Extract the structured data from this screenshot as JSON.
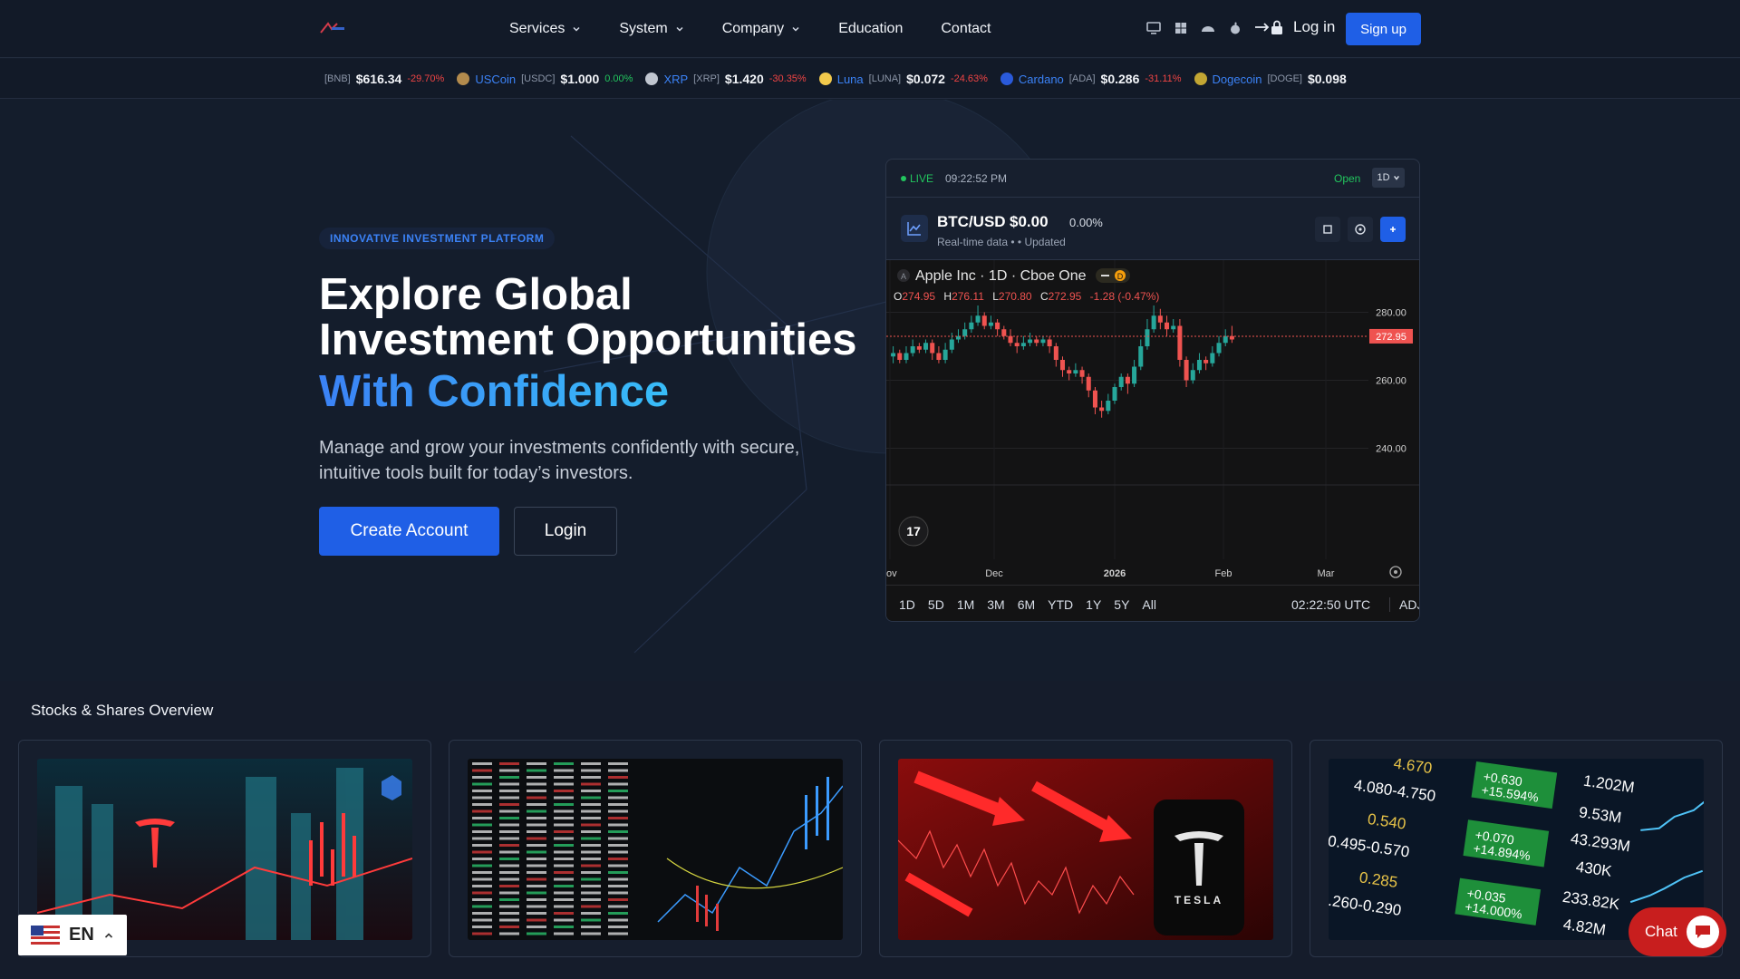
{
  "nav": {
    "menu": [
      {
        "label": "Services",
        "dropdown": true
      },
      {
        "label": "System",
        "dropdown": true
      },
      {
        "label": "Company",
        "dropdown": true
      },
      {
        "label": "Education",
        "dropdown": false
      },
      {
        "label": "Contact",
        "dropdown": false
      }
    ],
    "os_icons": [
      "desktop-icon",
      "windows-icon",
      "android-icon",
      "apple-icon"
    ],
    "login_label": "Log in",
    "signup_label": "Sign up"
  },
  "ticker": [
    {
      "name": "",
      "symbol": "[BNB]",
      "price": "$616.34",
      "change": "-29.70%",
      "dir": "neg",
      "color": "#f3ba2f"
    },
    {
      "name": "USCoin",
      "symbol": "[USDC]",
      "price": "$1.000",
      "change": "0.00%",
      "dir": "pos",
      "color": "#b38b4d"
    },
    {
      "name": "XRP",
      "symbol": "[XRP]",
      "price": "$1.420",
      "change": "-30.35%",
      "dir": "neg",
      "color": "#c0c6d0"
    },
    {
      "name": "Luna",
      "symbol": "[LUNA]",
      "price": "$0.072",
      "change": "-24.63%",
      "dir": "neg",
      "color": "#f2c94c"
    },
    {
      "name": "Cardano",
      "symbol": "[ADA]",
      "price": "$0.286",
      "change": "-31.11%",
      "dir": "neg",
      "color": "#2a5ada"
    },
    {
      "name": "Dogecoin",
      "symbol": "[DOGE]",
      "price": "$0.098",
      "change": "",
      "dir": "neg",
      "color": "#c2a633"
    }
  ],
  "hero": {
    "badge": "INNOVATIVE INVESTMENT PLATFORM",
    "title": "Explore Global Investment Opportunities",
    "accent": "With Confidence",
    "subtitle": "Manage and grow your investments confidently with secure, intuitive tools built for today’s investors.",
    "primary_cta": "Create Account",
    "secondary_cta": "Login"
  },
  "widget": {
    "live_label": "LIVE",
    "clock": "09:22:52 PM",
    "status": "Open",
    "period": "1D",
    "pair": "BTC/USD",
    "price": "$0.00",
    "change": "0.00%",
    "meta": "Real-time data •  • Updated",
    "symbol_line": "Apple Inc · 1D · Cboe One",
    "ohlc": {
      "o_label": "O",
      "o": "274.95",
      "h_label": "H",
      "h": "276.11",
      "l_label": "L",
      "l": "270.80",
      "c_label": "C",
      "c": "272.95",
      "chg": "-1.28 (-0.47%)"
    },
    "last_price_tag": "272.95",
    "y_ticks": [
      "280.00",
      "260.00",
      "240.00"
    ],
    "x_ticks": [
      "ov",
      "Dec",
      "2026",
      "Feb",
      "Mar"
    ],
    "ranges": [
      "1D",
      "5D",
      "1M",
      "3M",
      "6M",
      "YTD",
      "1Y",
      "5Y",
      "All"
    ],
    "utc_time": "02:22:50 UTC",
    "adj_label": "ADJ",
    "candles": [
      {
        "o": 267,
        "c": 268,
        "h": 270,
        "l": 265
      },
      {
        "o": 268,
        "c": 266,
        "h": 269,
        "l": 265
      },
      {
        "o": 266,
        "c": 268,
        "h": 270,
        "l": 265
      },
      {
        "o": 268,
        "c": 270,
        "h": 272,
        "l": 267
      },
      {
        "o": 270,
        "c": 269,
        "h": 271,
        "l": 268
      },
      {
        "o": 269,
        "c": 271,
        "h": 272,
        "l": 268
      },
      {
        "o": 271,
        "c": 268,
        "h": 272,
        "l": 266
      },
      {
        "o": 268,
        "c": 266,
        "h": 270,
        "l": 265
      },
      {
        "o": 266,
        "c": 269,
        "h": 271,
        "l": 265
      },
      {
        "o": 269,
        "c": 272,
        "h": 274,
        "l": 268
      },
      {
        "o": 272,
        "c": 273,
        "h": 275,
        "l": 271
      },
      {
        "o": 273,
        "c": 275,
        "h": 277,
        "l": 272
      },
      {
        "o": 275,
        "c": 277,
        "h": 279,
        "l": 274
      },
      {
        "o": 277,
        "c": 279,
        "h": 282,
        "l": 276
      },
      {
        "o": 279,
        "c": 276,
        "h": 280,
        "l": 275
      },
      {
        "o": 276,
        "c": 277,
        "h": 279,
        "l": 275
      },
      {
        "o": 277,
        "c": 275,
        "h": 278,
        "l": 273
      },
      {
        "o": 275,
        "c": 273,
        "h": 276,
        "l": 272
      },
      {
        "o": 273,
        "c": 271,
        "h": 275,
        "l": 270
      },
      {
        "o": 271,
        "c": 270,
        "h": 273,
        "l": 268
      },
      {
        "o": 270,
        "c": 271,
        "h": 273,
        "l": 269
      },
      {
        "o": 271,
        "c": 272,
        "h": 274,
        "l": 270
      },
      {
        "o": 272,
        "c": 271,
        "h": 273,
        "l": 270
      },
      {
        "o": 271,
        "c": 272,
        "h": 273,
        "l": 270
      },
      {
        "o": 272,
        "c": 270,
        "h": 273,
        "l": 268
      },
      {
        "o": 270,
        "c": 266,
        "h": 271,
        "l": 264
      },
      {
        "o": 266,
        "c": 263,
        "h": 267,
        "l": 261
      },
      {
        "o": 263,
        "c": 262,
        "h": 264,
        "l": 260
      },
      {
        "o": 262,
        "c": 263,
        "h": 265,
        "l": 261
      },
      {
        "o": 263,
        "c": 261,
        "h": 264,
        "l": 259
      },
      {
        "o": 261,
        "c": 257,
        "h": 262,
        "l": 255
      },
      {
        "o": 257,
        "c": 252,
        "h": 258,
        "l": 250
      },
      {
        "o": 252,
        "c": 251,
        "h": 254,
        "l": 249
      },
      {
        "o": 251,
        "c": 254,
        "h": 256,
        "l": 250
      },
      {
        "o": 254,
        "c": 258,
        "h": 259,
        "l": 253
      },
      {
        "o": 258,
        "c": 261,
        "h": 262,
        "l": 257
      },
      {
        "o": 261,
        "c": 259,
        "h": 262,
        "l": 256
      },
      {
        "o": 259,
        "c": 264,
        "h": 266,
        "l": 258
      },
      {
        "o": 264,
        "c": 270,
        "h": 272,
        "l": 263
      },
      {
        "o": 270,
        "c": 275,
        "h": 278,
        "l": 269
      },
      {
        "o": 275,
        "c": 279,
        "h": 282,
        "l": 274
      },
      {
        "o": 279,
        "c": 277,
        "h": 281,
        "l": 275
      },
      {
        "o": 277,
        "c": 275,
        "h": 279,
        "l": 273
      },
      {
        "o": 275,
        "c": 276,
        "h": 278,
        "l": 274
      },
      {
        "o": 276,
        "c": 266,
        "h": 278,
        "l": 264
      },
      {
        "o": 266,
        "c": 260,
        "h": 267,
        "l": 258
      },
      {
        "o": 260,
        "c": 263,
        "h": 265,
        "l": 259
      },
      {
        "o": 263,
        "c": 266,
        "h": 268,
        "l": 262
      },
      {
        "o": 266,
        "c": 265,
        "h": 267,
        "l": 263
      },
      {
        "o": 265,
        "c": 268,
        "h": 270,
        "l": 264
      },
      {
        "o": 268,
        "c": 271,
        "h": 273,
        "l": 267
      },
      {
        "o": 271,
        "c": 273,
        "h": 275,
        "l": 270
      },
      {
        "o": 273,
        "c": 272,
        "h": 276,
        "l": 271
      }
    ]
  },
  "overview": {
    "title": "Stocks & Shares Overview",
    "card_images": [
      "tesla-city-chart-image",
      "stock-table-image",
      "tesla-decline-image",
      "market-board-image"
    ]
  },
  "footer_widgets": {
    "language": "EN",
    "chat_label": "Chat"
  },
  "colors": {
    "accent": "#1f5fe6",
    "up": "#22c55e",
    "down": "#ef4444",
    "candle_up": "#26a69a",
    "candle_down": "#ef5350"
  }
}
